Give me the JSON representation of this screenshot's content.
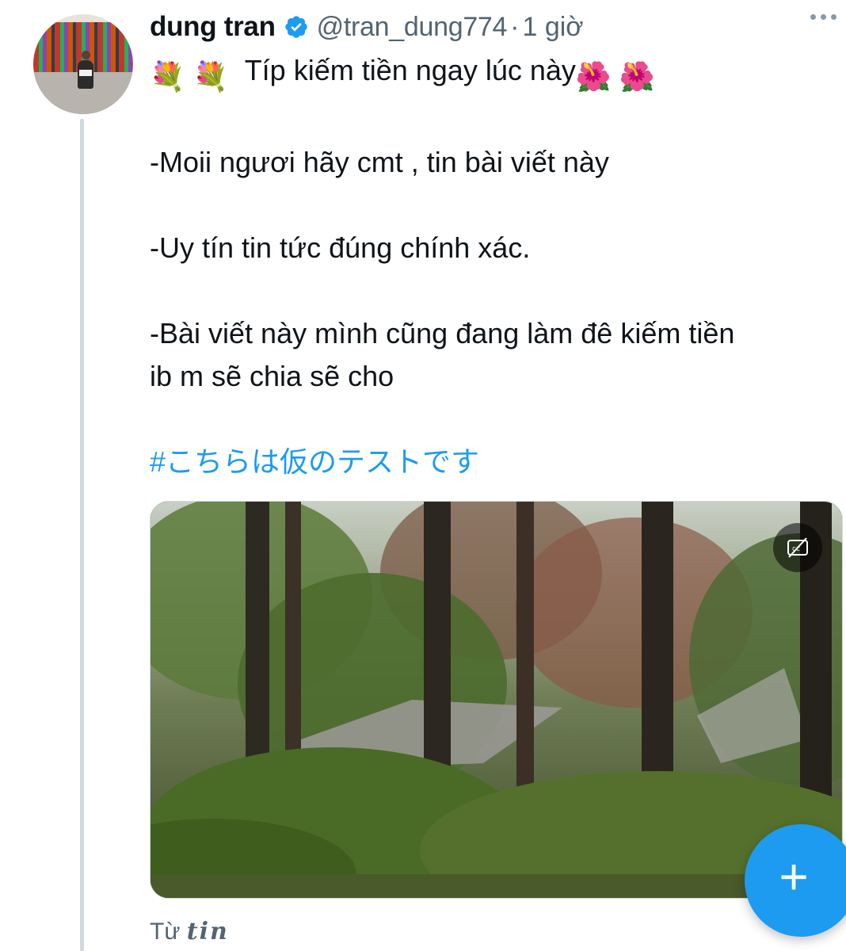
{
  "tweet": {
    "author": {
      "display_name": "dung tran",
      "handle": "@tran_dung774",
      "verified": true,
      "avatar_icon": "profile-photo"
    },
    "time_separator": "·",
    "time": "1 giờ",
    "text_lines": [
      "Típ kiếm tiền ngay lúc này",
      "-Moii ngươi hãy cmt , tin bài viết này",
      "-Uy tín tin tức đúng chính xác.",
      "-Bài viết này mình cũng đang làm đê kiếm tiền",
      "ib m sẽ chia sẽ cho"
    ],
    "emojis": {
      "leading": [
        "💐",
        "💐"
      ],
      "trailing": [
        "🌺",
        "🌺"
      ]
    },
    "hashtag": "#こちらは仮のテストです",
    "media": {
      "type": "video",
      "description_icon": "forest-video",
      "captions_icon": "closed-captions-off-icon"
    },
    "translated_from_prefix": "Từ",
    "translated_from_source": "tin"
  },
  "compose_button": {
    "icon": "plus-icon",
    "label": "+"
  },
  "colors": {
    "accent": "#1d9bf0",
    "secondary_text": "#536471",
    "primary_text": "#0f1419",
    "thread_line": "#cfd9de"
  }
}
